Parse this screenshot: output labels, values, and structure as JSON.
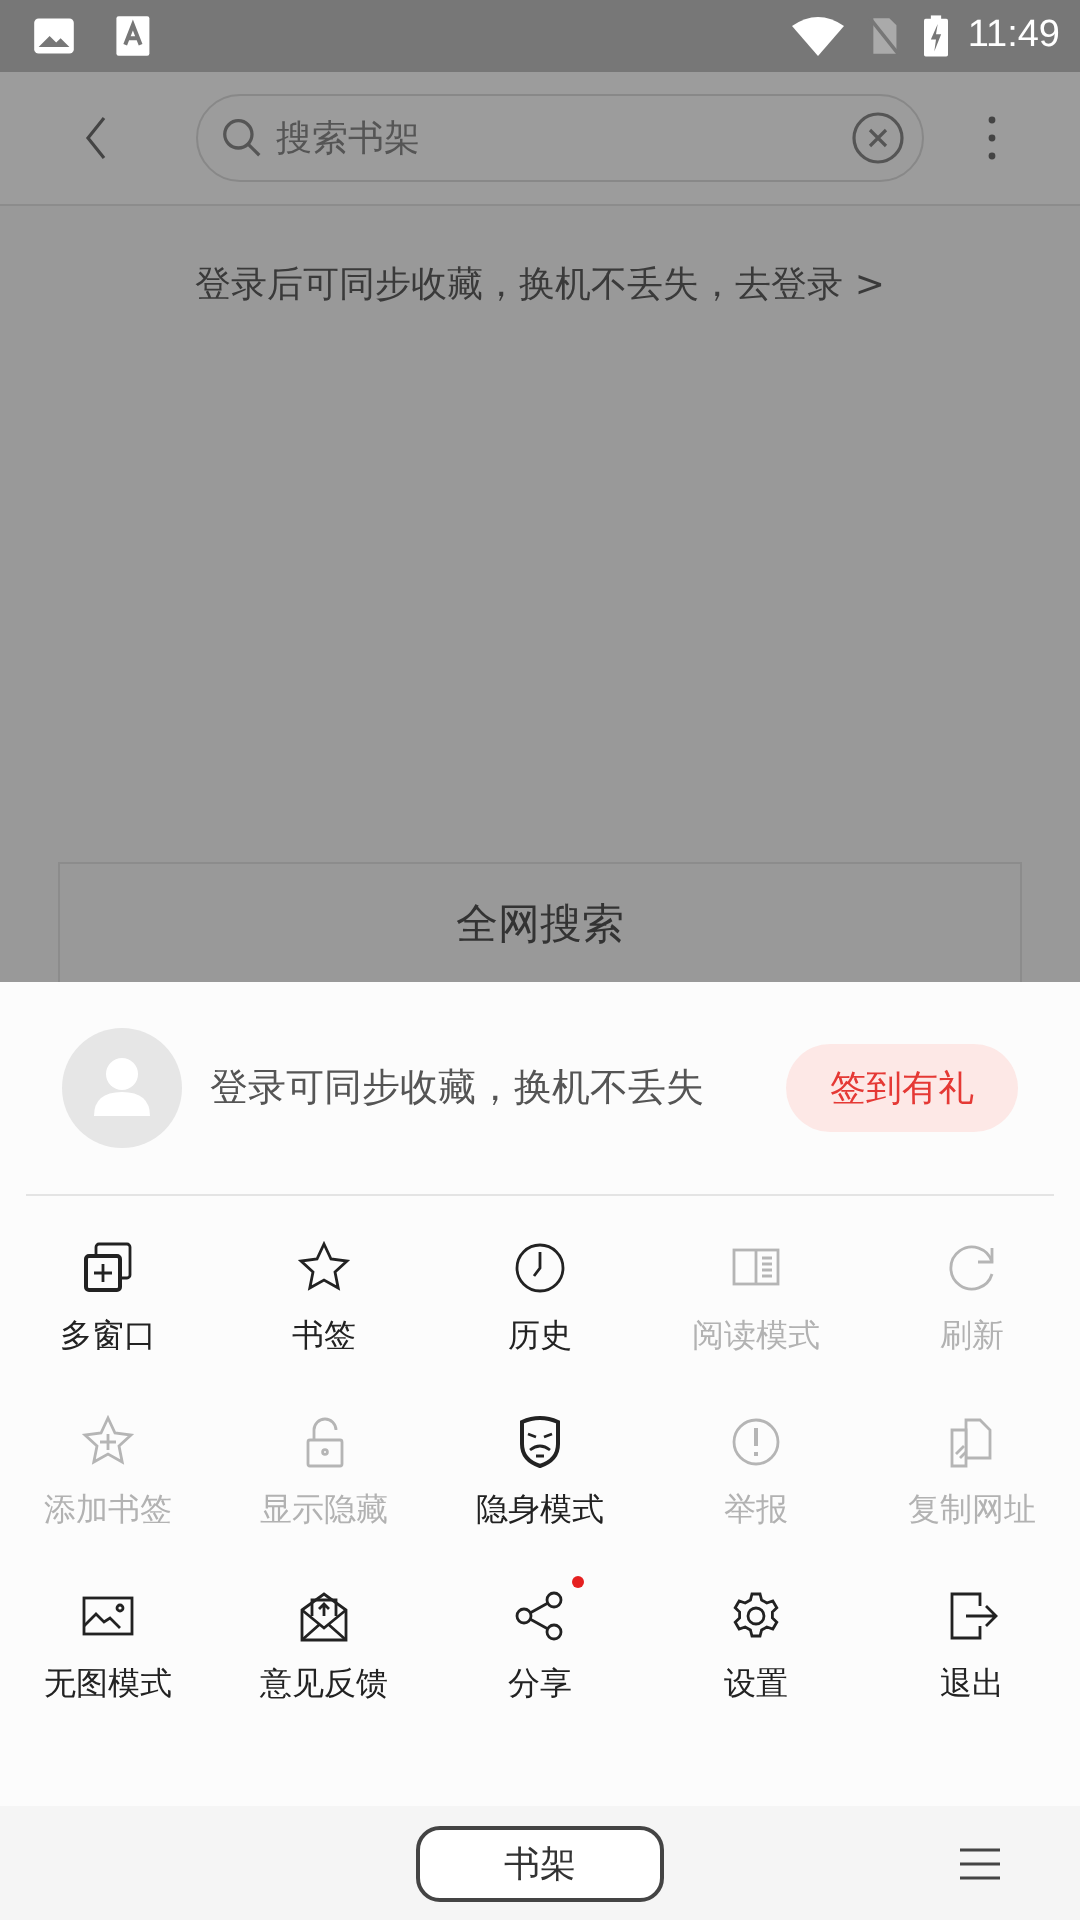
{
  "status_bar": {
    "time": "11:49"
  },
  "search": {
    "placeholder": "搜索书架"
  },
  "login_banner": "登录后可同步收藏，换机不丢失，去登录 >",
  "web_search_button": "全网搜索",
  "menu": {
    "profile_text": "登录可同步收藏，换机不丢失",
    "checkin_button": "签到有礼",
    "items": [
      {
        "label": "多窗口",
        "kind": "windows",
        "disabled": false,
        "badge": false
      },
      {
        "label": "书签",
        "kind": "star",
        "disabled": false,
        "badge": false
      },
      {
        "label": "历史",
        "kind": "clock",
        "disabled": false,
        "badge": false
      },
      {
        "label": "阅读模式",
        "kind": "reader",
        "disabled": true,
        "badge": false
      },
      {
        "label": "刷新",
        "kind": "refresh",
        "disabled": true,
        "badge": false
      },
      {
        "label": "添加书签",
        "kind": "star-plus",
        "disabled": true,
        "badge": false
      },
      {
        "label": "显示隐藏",
        "kind": "lock",
        "disabled": true,
        "badge": false
      },
      {
        "label": "隐身模式",
        "kind": "mask",
        "disabled": false,
        "badge": false
      },
      {
        "label": "举报",
        "kind": "alert",
        "disabled": true,
        "badge": false
      },
      {
        "label": "复制网址",
        "kind": "copy-link",
        "disabled": true,
        "badge": false
      },
      {
        "label": "无图模式",
        "kind": "image",
        "disabled": false,
        "badge": false
      },
      {
        "label": "意见反馈",
        "kind": "mail",
        "disabled": false,
        "badge": false
      },
      {
        "label": "分享",
        "kind": "share",
        "disabled": false,
        "badge": true
      },
      {
        "label": "设置",
        "kind": "gear",
        "disabled": false,
        "badge": false
      },
      {
        "label": "退出",
        "kind": "exit",
        "disabled": false,
        "badge": false
      }
    ]
  },
  "bottom_bar": {
    "bookshelf_button": "书架"
  }
}
